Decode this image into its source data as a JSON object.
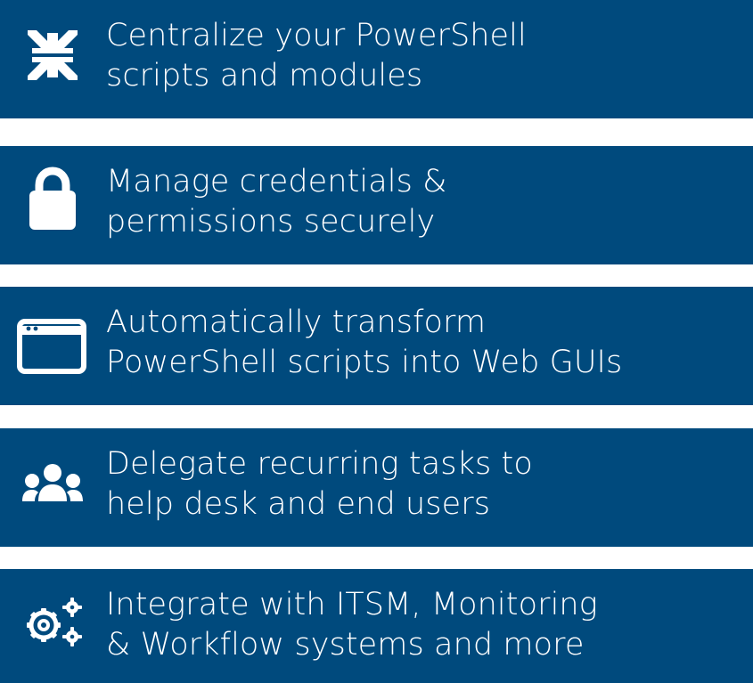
{
  "colors": {
    "banner_background": "#004a7d",
    "text": "#ffffff",
    "icon": "#ffffff",
    "gap": "#ffffff"
  },
  "features": [
    {
      "icon": "compress-arrows-icon",
      "lines": [
        "Centralize your PowerShell",
        "scripts and modules"
      ]
    },
    {
      "icon": "lock-icon",
      "lines": [
        "Manage credentials &",
        "permissions securely"
      ]
    },
    {
      "icon": "browser-window-icon",
      "lines": [
        "Automatically transform",
        "PowerShell scripts into Web GUIs"
      ]
    },
    {
      "icon": "users-group-icon",
      "lines": [
        "Delegate recurring tasks to",
        "help desk and end users"
      ]
    },
    {
      "icon": "gears-icon",
      "lines": [
        "Integrate with ITSM, Monitoring",
        "& Workflow systems and more"
      ]
    }
  ]
}
